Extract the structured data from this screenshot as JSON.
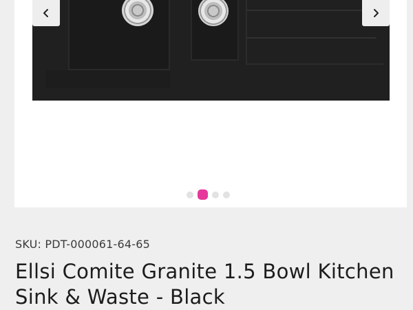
{
  "gallery": {
    "prev_icon": "chevron-left-icon",
    "next_icon": "chevron-right-icon",
    "image_alt": "product-image",
    "dot_count": 4,
    "active_dot": 2,
    "active_color": "#e5389a",
    "inactive_color": "#e2e2e2"
  },
  "product": {
    "sku": "SKU: PDT-000061-64-65",
    "title": "Ellsi Comite Granite 1.5 Bowl Kitchen Sink & Waste - Black"
  }
}
